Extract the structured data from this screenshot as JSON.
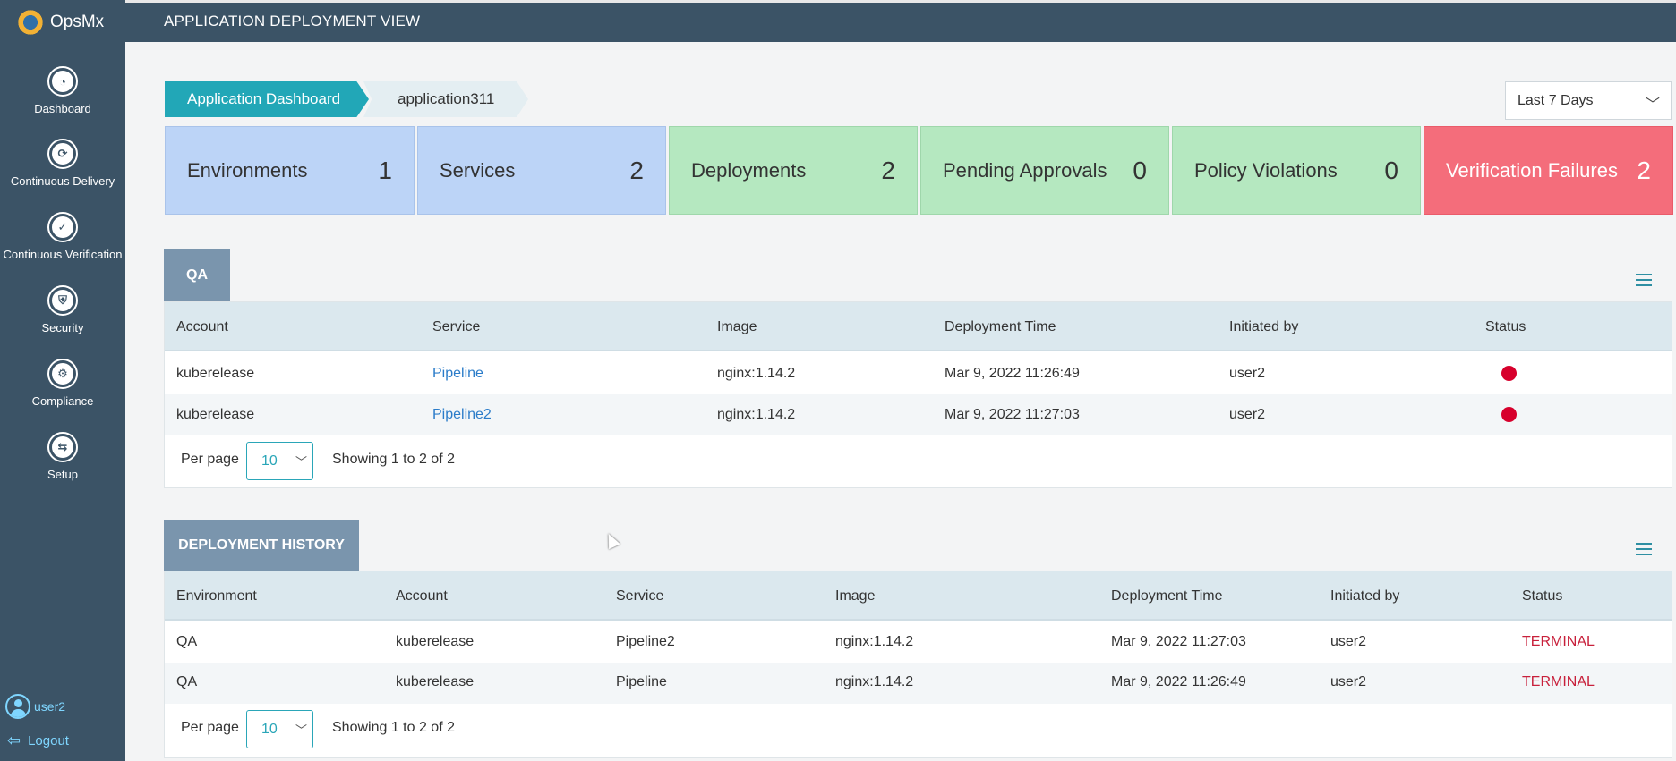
{
  "brand": {
    "name": "OpsMx"
  },
  "header": {
    "title": "APPLICATION DEPLOYMENT VIEW"
  },
  "sidebar": {
    "items": [
      {
        "label": "Dashboard",
        "icon": "dashboard-icon"
      },
      {
        "label": "Continuous Delivery",
        "icon": "continuous-delivery-icon"
      },
      {
        "label": "Continuous Verification",
        "icon": "continuous-verification-icon"
      },
      {
        "label": "Security",
        "icon": "security-icon"
      },
      {
        "label": "Compliance",
        "icon": "compliance-icon"
      },
      {
        "label": "Setup",
        "icon": "setup-icon"
      }
    ],
    "user": "user2",
    "logout": "Logout"
  },
  "breadcrumb": {
    "root": "Application Dashboard",
    "current": "application311"
  },
  "date_range": {
    "selected": "Last 7 Days"
  },
  "summary": [
    {
      "label": "Environments",
      "count": "1",
      "color": "#bcd4f7"
    },
    {
      "label": "Services",
      "count": "2",
      "color": "#bcd4f7"
    },
    {
      "label": "Deployments",
      "count": "2",
      "color": "#b5e8c0"
    },
    {
      "label": "Pending Approvals",
      "count": "0",
      "color": "#b5e8c0"
    },
    {
      "label": "Policy Violations",
      "count": "0",
      "color": "#b5e8c0"
    },
    {
      "label": "Verification Failures",
      "count": "2",
      "color": "#f46d7b"
    }
  ],
  "qa": {
    "tab": "QA",
    "columns": [
      "Account",
      "Service",
      "Image",
      "Deployment Time",
      "Initiated by",
      "Status"
    ],
    "rows": [
      {
        "account": "kuberelease",
        "service": "Pipeline",
        "image": "nginx:1.14.2",
        "time": "Mar 9, 2022 11:26:49",
        "initiated_by": "user2",
        "status": "failed"
      },
      {
        "account": "kuberelease",
        "service": "Pipeline2",
        "image": "nginx:1.14.2",
        "time": "Mar 9, 2022 11:27:03",
        "initiated_by": "user2",
        "status": "failed"
      }
    ],
    "per_page_label": "Per page",
    "per_page": "10",
    "showing": "Showing 1 to 2 of 2"
  },
  "history": {
    "tab": "DEPLOYMENT HISTORY",
    "columns": [
      "Environment",
      "Account",
      "Service",
      "Image",
      "Deployment Time",
      "Initiated by",
      "Status"
    ],
    "rows": [
      {
        "environment": "QA",
        "account": "kuberelease",
        "service": "Pipeline2",
        "image": "nginx:1.14.2",
        "time": "Mar 9, 2022 11:27:03",
        "initiated_by": "user2",
        "status": "TERMINAL"
      },
      {
        "environment": "QA",
        "account": "kuberelease",
        "service": "Pipeline",
        "image": "nginx:1.14.2",
        "time": "Mar 9, 2022 11:26:49",
        "initiated_by": "user2",
        "status": "TERMINAL"
      }
    ],
    "per_page_label": "Per page",
    "per_page": "10",
    "showing": "Showing 1 to 2 of 2"
  },
  "colors": {
    "sidebar": "#3b5366",
    "accent": "#22a7b7",
    "status_failed": "#d7002c",
    "terminal": "#c8203b"
  }
}
